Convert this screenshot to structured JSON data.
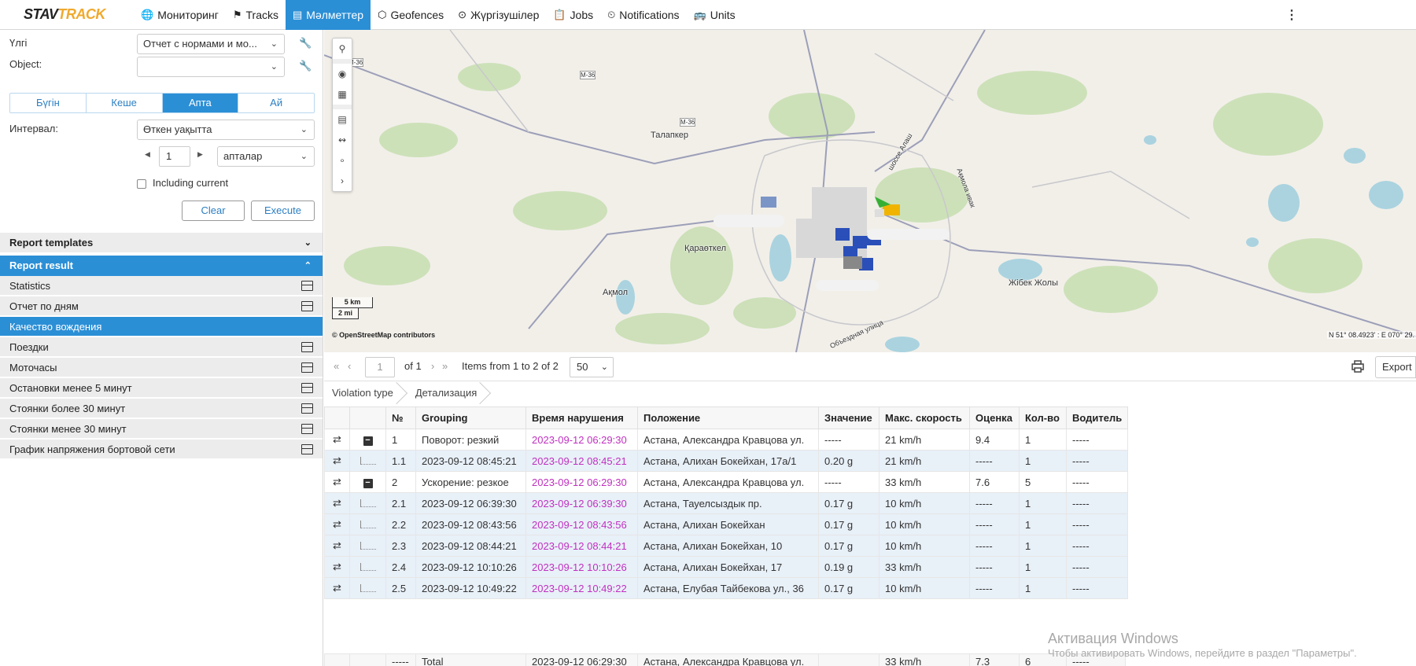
{
  "brand": {
    "logo_text_a": "STAV",
    "logo_text_b": "TRACK"
  },
  "nav": {
    "items": [
      {
        "label": "Мониторинг",
        "icon": "globe-icon"
      },
      {
        "label": "Tracks",
        "icon": "flag-icon"
      },
      {
        "label": "Мәлметтер",
        "icon": "report-icon",
        "active": true
      },
      {
        "label": "Geofences",
        "icon": "polygon-icon"
      },
      {
        "label": "Жүргізушілер",
        "icon": "steering-wheel-icon"
      },
      {
        "label": "Jobs",
        "icon": "clipboard-icon"
      },
      {
        "label": "Notifications",
        "icon": "bell-clock-icon"
      },
      {
        "label": "Units",
        "icon": "bus-icon"
      }
    ],
    "more": "⋮"
  },
  "form": {
    "template_label": "Үлгі",
    "template_value": "Отчет с нормами и мо...",
    "object_label": "Object:",
    "object_value": "",
    "periods": [
      "Бүгін",
      "Кеше",
      "Апта",
      "Ай"
    ],
    "active_period": "Апта",
    "interval_label": "Интервал:",
    "interval_value": "Өткен уақытта",
    "count_value": "1",
    "unit_value": "апталар",
    "including_current": "Including current",
    "clear": "Clear",
    "execute": "Execute"
  },
  "panels": {
    "templates": "Report templates",
    "result": "Report result"
  },
  "report_items": [
    "Statistics",
    "Отчет по дням",
    "Качество вождения",
    "Поездки",
    "Моточасы",
    "Остановки менее 5 минут",
    "Стоянки более 30 минут",
    "Стоянки менее 30 минут",
    "График напряжения бортовой сети"
  ],
  "selected_report": "Качество вождения",
  "map": {
    "labels": [
      "Талапкер",
      "Қараөткел",
      "Ақмол",
      "Жібек Жолы",
      "М-36",
      "М-36",
      "М-36",
      "Объездная улица",
      "шоссе Алаш",
      "Ақмола ивак"
    ],
    "scale_km": "5 km",
    "scale_mi": "2 mi",
    "attribution": "© OpenStreetMap contributors",
    "coords": "N 51° 08.4923' : E 070° 29."
  },
  "pager": {
    "page": "1",
    "of": "of 1",
    "items": "Items from 1 to 2 of 2",
    "per_page": "50",
    "export": "Export"
  },
  "breadcrumbs": [
    "Violation type",
    "Детализация"
  ],
  "table": {
    "headers": [
      "№",
      "Grouping",
      "Время нарушения",
      "Положение",
      "Значение",
      "Макс. скорость",
      "Оценка",
      "Кол-во",
      "Водитель"
    ],
    "rows": [
      {
        "kind": "main",
        "no": "1",
        "grouping": "Поворот: резкий",
        "time": "2023-09-12 06:29:30",
        "pos": "Астана, Александра Кравцова ул.",
        "val": "-----",
        "speed": "21 km/h",
        "score": "9.4",
        "count": "1",
        "driver": "-----"
      },
      {
        "kind": "sub",
        "no": "1.1",
        "grouping": "2023-09-12 08:45:21",
        "time": "2023-09-12 08:45:21",
        "pos": "Астана, Алихан Бокейхан, 17а/1",
        "val": "0.20 g",
        "speed": "21 km/h",
        "score": "-----",
        "count": "1",
        "driver": "-----"
      },
      {
        "kind": "main",
        "no": "2",
        "grouping": "Ускорение: резкое",
        "time": "2023-09-12 06:29:30",
        "pos": "Астана, Александра Кравцова ул.",
        "val": "-----",
        "speed": "33 km/h",
        "score": "7.6",
        "count": "5",
        "driver": "-----"
      },
      {
        "kind": "sub",
        "no": "2.1",
        "grouping": "2023-09-12 06:39:30",
        "time": "2023-09-12 06:39:30",
        "pos": "Астана, Тауелсыздык пр.",
        "val": "0.17 g",
        "speed": "10 km/h",
        "score": "-----",
        "count": "1",
        "driver": "-----"
      },
      {
        "kind": "sub",
        "no": "2.2",
        "grouping": "2023-09-12 08:43:56",
        "time": "2023-09-12 08:43:56",
        "pos": "Астана, Алихан Бокейхан",
        "val": "0.17 g",
        "speed": "10 km/h",
        "score": "-----",
        "count": "1",
        "driver": "-----"
      },
      {
        "kind": "sub",
        "no": "2.3",
        "grouping": "2023-09-12 08:44:21",
        "time": "2023-09-12 08:44:21",
        "pos": "Астана, Алихан Бокейхан, 10",
        "val": "0.17 g",
        "speed": "10 km/h",
        "score": "-----",
        "count": "1",
        "driver": "-----"
      },
      {
        "kind": "sub",
        "no": "2.4",
        "grouping": "2023-09-12 10:10:26",
        "time": "2023-09-12 10:10:26",
        "pos": "Астана, Алихан Бокейхан, 17",
        "val": "0.19 g",
        "speed": "33 km/h",
        "score": "-----",
        "count": "1",
        "driver": "-----"
      },
      {
        "kind": "sub",
        "no": "2.5",
        "grouping": "2023-09-12 10:49:22",
        "time": "2023-09-12 10:49:22",
        "pos": "Астана, Елубая Тайбекова ул., 36",
        "val": "0.17 g",
        "speed": "10 km/h",
        "score": "-----",
        "count": "1",
        "driver": "-----"
      }
    ],
    "total": {
      "no": "-----",
      "grouping": "Total",
      "time": "2023-09-12 06:29:30",
      "pos": "Астана, Александра Кравцова ул.",
      "val": "",
      "speed": "33 km/h",
      "score": "7.3",
      "count": "6",
      "driver": "-----"
    }
  },
  "watermark": {
    "title": "Активация Windows",
    "sub": "Чтобы активировать Windows, перейдите в раздел \"Параметры\"."
  }
}
